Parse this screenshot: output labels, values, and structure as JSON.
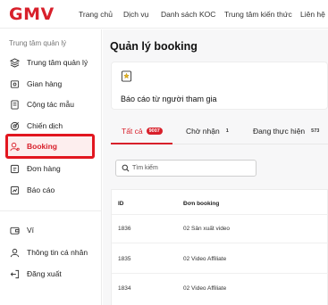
{
  "header": {
    "logo": "GMV",
    "nav": [
      "Trang chủ",
      "Dịch vụ",
      "Danh sách KOC",
      "Trung tâm kiến thức",
      "Liên hệ"
    ]
  },
  "sidebar": {
    "section_title": "Trung tâm quản lý",
    "items": [
      {
        "label": "Trung tâm quản lý",
        "icon": "layers-icon"
      },
      {
        "label": "Gian hàng",
        "icon": "store-icon"
      },
      {
        "label": "Cộng tác mẫu",
        "icon": "document-icon"
      },
      {
        "label": "Chiến dịch",
        "icon": "target-icon"
      },
      {
        "label": "Booking",
        "icon": "user-pin-icon",
        "active": true
      },
      {
        "label": "Đơn hàng",
        "icon": "order-icon"
      },
      {
        "label": "Báo cáo",
        "icon": "chart-icon"
      }
    ],
    "bottom_items": [
      {
        "label": "Ví",
        "icon": "wallet-icon"
      },
      {
        "label": "Thông tin cá nhân",
        "icon": "user-icon"
      },
      {
        "label": "Đăng xuất",
        "icon": "logout-icon"
      }
    ]
  },
  "main": {
    "title": "Quản lý booking",
    "card": {
      "label": "Báo cáo từ người tham gia",
      "icon": "star-doc-icon"
    },
    "tabs": [
      {
        "label": "Tất cả",
        "badge": "9007",
        "active": true
      },
      {
        "label": "Chờ nhận",
        "badge": "1"
      },
      {
        "label": "Đang thực hiện",
        "badge": "573"
      }
    ],
    "search": {
      "placeholder": "Tìm kiếm",
      "icon": "search-icon"
    },
    "table": {
      "columns": [
        "ID",
        "Đơn booking"
      ],
      "rows": [
        [
          "1836",
          "02 Sản xuất video"
        ],
        [
          "1835",
          "02 Video Affiliate"
        ],
        [
          "1834",
          "02 Video Affiliate"
        ]
      ]
    }
  },
  "colors": {
    "accent": "#d8202b",
    "highlight_box": "#e2161f"
  }
}
